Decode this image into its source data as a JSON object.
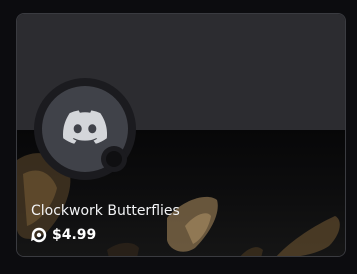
{
  "item": {
    "name": "Clockwork Butterflies",
    "price": "$4.99",
    "currency_icon": "orb-icon",
    "avatar_icon": "discord-logo-icon"
  },
  "colors": {
    "background": "#0c0c0f",
    "card_border": "#3a3b40",
    "banner": "#2c2c30",
    "avatar": "#404249",
    "text": "#f2f3f5"
  }
}
